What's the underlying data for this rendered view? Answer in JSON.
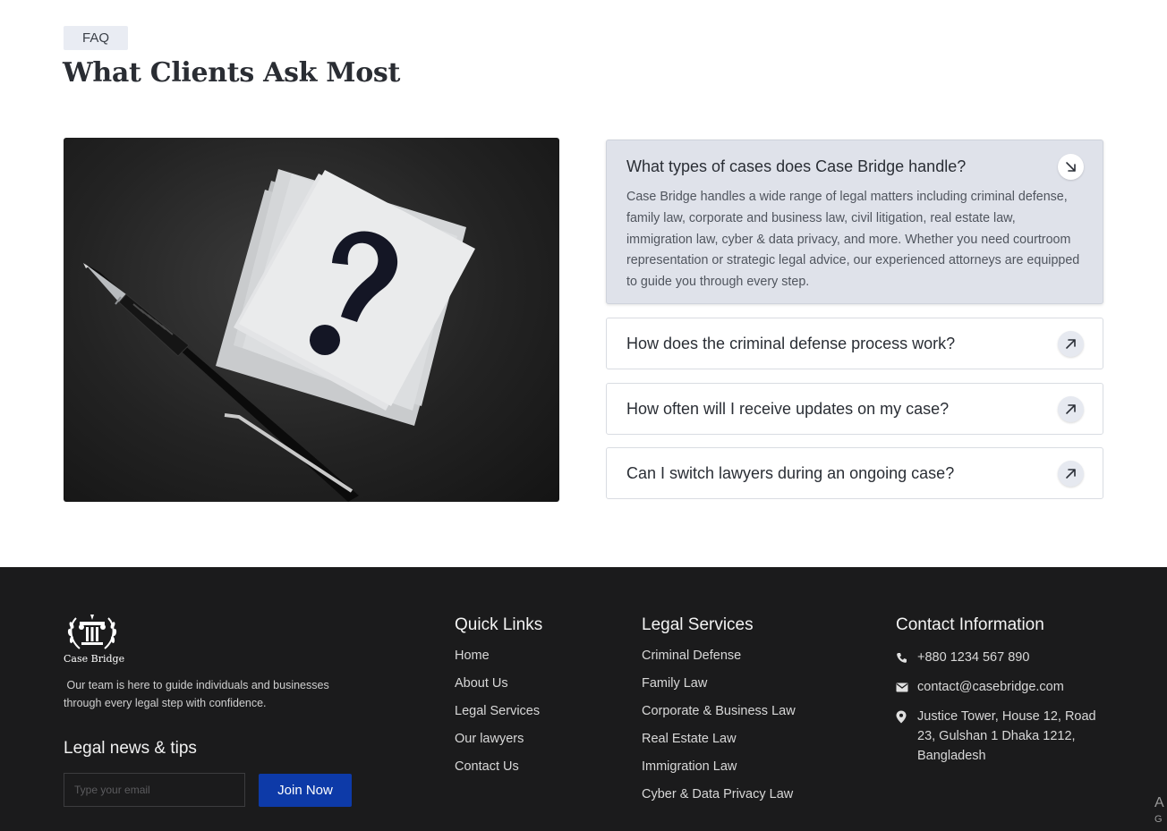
{
  "faq": {
    "badge": "FAQ",
    "title": "What Clients Ask Most",
    "items": [
      {
        "question": "What types of cases does Case Bridge handle?",
        "answer": "Case Bridge handles a wide range of legal matters including criminal defense, family law, corporate and business law, civil litigation, real estate law, immigration law, cyber & data privacy, and more. Whether you need courtroom representation or strategic legal advice, our experienced attorneys are equipped to guide you through every step.",
        "expanded": true,
        "icon": "arrow-down-right-icon"
      },
      {
        "question": "How does the criminal defense process work?",
        "expanded": false,
        "icon": "arrow-up-right-icon"
      },
      {
        "question": "How often will I receive updates on my case?",
        "expanded": false,
        "icon": "arrow-up-right-icon"
      },
      {
        "question": "Can I switch lawyers during an ongoing case?",
        "expanded": false,
        "icon": "arrow-up-right-icon"
      }
    ]
  },
  "footer": {
    "brand_name": "Case Bridge",
    "description": " Our team is here to guide individuals and businesses through every legal step with confidence.",
    "newsletter": {
      "title": "Legal news & tips",
      "placeholder": "Type your email",
      "button_label": "Join Now"
    },
    "quick_links": {
      "title": "Quick Links",
      "items": [
        "Home",
        "About Us",
        "Legal Services",
        "Our lawyers",
        "Contact Us"
      ]
    },
    "legal_services": {
      "title": "Legal Services",
      "items": [
        "Criminal Defense",
        "Family Law",
        "Corporate & Business Law",
        "Real Estate Law",
        "Immigration Law",
        "Cyber & Data Privacy Law"
      ]
    },
    "contact": {
      "title": "Contact Information",
      "phone": "+880 1234 567 890",
      "email": "contact@casebridge.com",
      "address": "Justice Tower, House 12, Road 23, Gulshan 1 Dhaka 1212, Bangladesh"
    }
  },
  "colors": {
    "footer_bg": "#1b1b1c",
    "accent_button": "#0d3aa8",
    "expanded_item_bg": "#dfe2ea"
  }
}
